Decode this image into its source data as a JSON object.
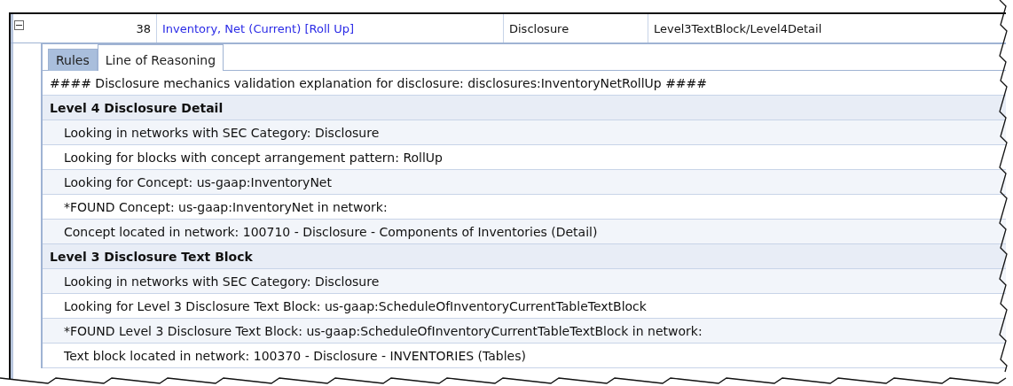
{
  "header_row": {
    "expanded": true,
    "number": "38",
    "name": "Inventory, Net (Current) [Roll Up]",
    "category": "Disclosure",
    "pattern": "Level3TextBlock/Level4Detail"
  },
  "tabs": [
    {
      "label": "Rules",
      "selected": false
    },
    {
      "label": "Line of Reasoning",
      "selected": true
    }
  ],
  "lines": [
    {
      "kind": "header",
      "text": "#### Disclosure mechanics validation explanation for disclosure: disclosures:InventoryNetRollUp ####"
    },
    {
      "kind": "group",
      "text": "Level 4 Disclosure Detail"
    },
    {
      "kind": "item",
      "text": "Looking in networks with SEC Category: Disclosure"
    },
    {
      "kind": "item",
      "text": "Looking for blocks with concept arrangement pattern: RollUp"
    },
    {
      "kind": "item",
      "text": "Looking for Concept: us-gaap:InventoryNet"
    },
    {
      "kind": "item",
      "text": "*FOUND Concept: us-gaap:InventoryNet in network:"
    },
    {
      "kind": "item",
      "text": "Concept located in network: 100710 - Disclosure - Components of Inventories (Detail)"
    },
    {
      "kind": "group",
      "text": "Level 3 Disclosure Text Block"
    },
    {
      "kind": "item",
      "text": "Looking in networks with SEC Category: Disclosure"
    },
    {
      "kind": "item",
      "text": "Looking for Level 3 Disclosure Text Block: us-gaap:ScheduleOfInventoryCurrentTableTextBlock"
    },
    {
      "kind": "item",
      "text": "*FOUND Level 3 Disclosure Text Block: us-gaap:ScheduleOfInventoryCurrentTableTextBlock in network:"
    },
    {
      "kind": "item",
      "text": "Text block located in network: 100370 - Disclosure - INVENTORIES (Tables)"
    }
  ]
}
